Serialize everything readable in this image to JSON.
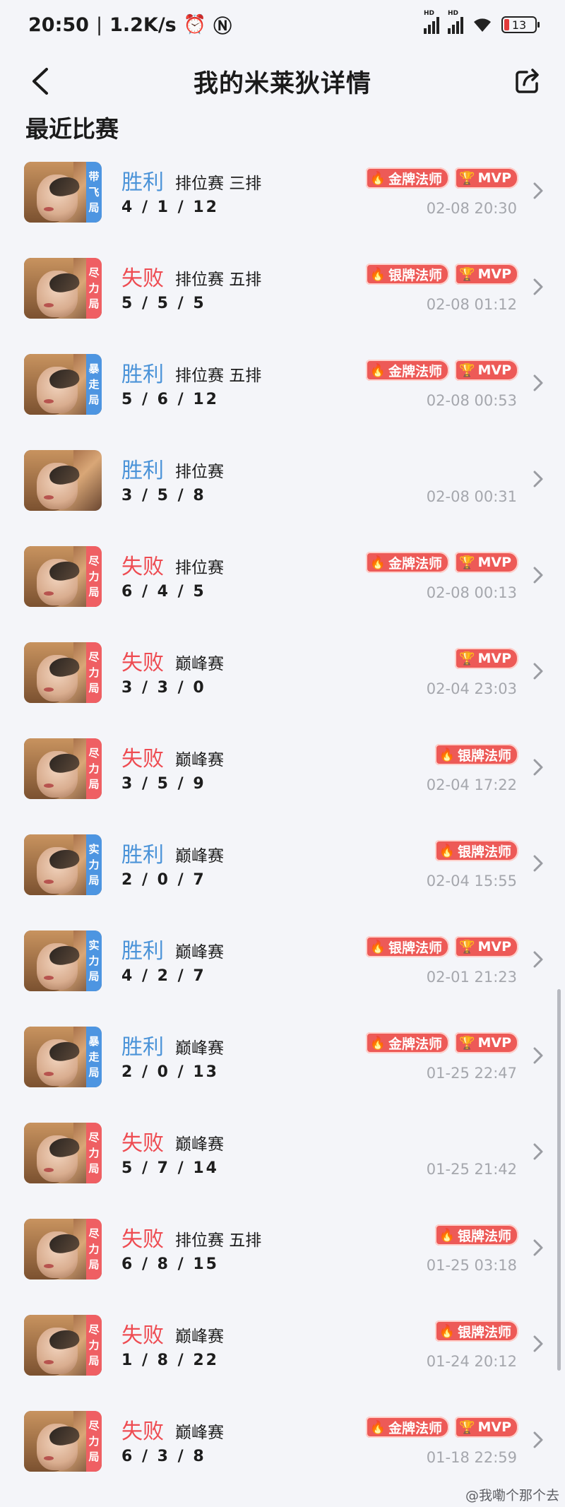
{
  "status_bar": {
    "time": "20:50",
    "network_speed": "1.2K/s",
    "battery_level": "13",
    "hd1": "HD",
    "hd2": "HD"
  },
  "header": {
    "title": "我的米莱狄详情"
  },
  "section_title": "最近比赛",
  "badge_labels": {
    "gold": "金牌法师",
    "silver": "银牌法师",
    "mvp": "MVP"
  },
  "colors": {
    "win": "#4b93d8",
    "loss": "#ee4c52",
    "badge": "#ed5a57",
    "tag_blue": "#4d95e1",
    "tag_red": "#ef5f63"
  },
  "matches": [
    {
      "result": "胜利",
      "outcome": "win",
      "type": "排位赛 三排",
      "kda": "4 / 1 / 12",
      "time": "02-08 20:30",
      "tag": "带飞局",
      "tag_color": "blue",
      "medal": "gold",
      "mvp": true
    },
    {
      "result": "失败",
      "outcome": "loss",
      "type": "排位赛 五排",
      "kda": "5 / 5 / 5",
      "time": "02-08 01:12",
      "tag": "尽力局",
      "tag_color": "red",
      "medal": "silver",
      "mvp": true
    },
    {
      "result": "胜利",
      "outcome": "win",
      "type": "排位赛 五排",
      "kda": "5 / 6 / 12",
      "time": "02-08 00:53",
      "tag": "暴走局",
      "tag_color": "blue",
      "medal": "gold",
      "mvp": true
    },
    {
      "result": "胜利",
      "outcome": "win",
      "type": "排位赛",
      "kda": "3 / 5 / 8",
      "time": "02-08 00:31",
      "tag": "",
      "tag_color": "",
      "medal": "",
      "mvp": false
    },
    {
      "result": "失败",
      "outcome": "loss",
      "type": "排位赛",
      "kda": "6 / 4 / 5",
      "time": "02-08 00:13",
      "tag": "尽力局",
      "tag_color": "red",
      "medal": "gold",
      "mvp": true
    },
    {
      "result": "失败",
      "outcome": "loss",
      "type": "巅峰赛",
      "kda": "3 / 3 / 0",
      "time": "02-04 23:03",
      "tag": "尽力局",
      "tag_color": "red",
      "medal": "",
      "mvp": true
    },
    {
      "result": "失败",
      "outcome": "loss",
      "type": "巅峰赛",
      "kda": "3 / 5 / 9",
      "time": "02-04 17:22",
      "tag": "尽力局",
      "tag_color": "red",
      "medal": "silver",
      "mvp": false
    },
    {
      "result": "胜利",
      "outcome": "win",
      "type": "巅峰赛",
      "kda": "2 / 0 / 7",
      "time": "02-04 15:55",
      "tag": "实力局",
      "tag_color": "blue",
      "medal": "silver",
      "mvp": false
    },
    {
      "result": "胜利",
      "outcome": "win",
      "type": "巅峰赛",
      "kda": "4 / 2 / 7",
      "time": "02-01 21:23",
      "tag": "实力局",
      "tag_color": "blue",
      "medal": "silver",
      "mvp": true
    },
    {
      "result": "胜利",
      "outcome": "win",
      "type": "巅峰赛",
      "kda": "2 / 0 / 13",
      "time": "01-25 22:47",
      "tag": "暴走局",
      "tag_color": "blue",
      "medal": "gold",
      "mvp": true
    },
    {
      "result": "失败",
      "outcome": "loss",
      "type": "巅峰赛",
      "kda": "5 / 7 / 14",
      "time": "01-25 21:42",
      "tag": "尽力局",
      "tag_color": "red",
      "medal": "",
      "mvp": false
    },
    {
      "result": "失败",
      "outcome": "loss",
      "type": "排位赛 五排",
      "kda": "6 / 8 / 15",
      "time": "01-25 03:18",
      "tag": "尽力局",
      "tag_color": "red",
      "medal": "silver",
      "mvp": false
    },
    {
      "result": "失败",
      "outcome": "loss",
      "type": "巅峰赛",
      "kda": "1 / 8 / 22",
      "time": "01-24 20:12",
      "tag": "尽力局",
      "tag_color": "red",
      "medal": "silver",
      "mvp": false
    },
    {
      "result": "失败",
      "outcome": "loss",
      "type": "巅峰赛",
      "kda": "6 / 3 / 8",
      "time": "01-18 22:59",
      "tag": "尽力局",
      "tag_color": "red",
      "medal": "gold",
      "mvp": true
    }
  ],
  "watermark": "@我嘞个那个去"
}
